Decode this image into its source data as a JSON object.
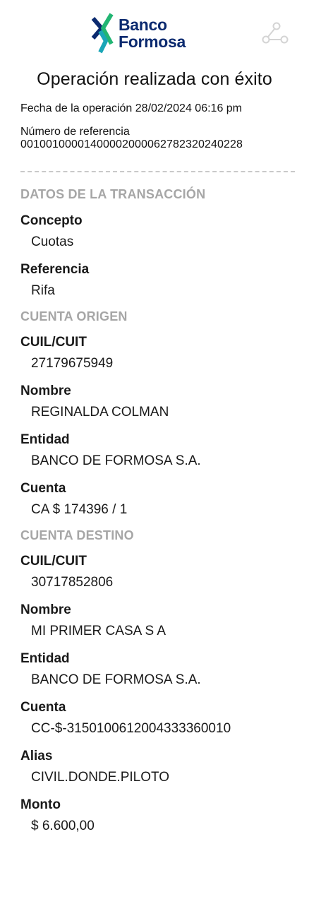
{
  "brand": {
    "name_line1": "Banco",
    "name_line2": "Formosa",
    "logo_icon": "banco-formosa-logo-icon",
    "share_icon": "share-icon"
  },
  "receipt": {
    "title": "Operación realizada con éxito",
    "date_line": "Fecha de la operación 28/02/2024 06:16 pm",
    "reference_label": "Número de referencia",
    "reference_number": "0010010000140000200006278232024022 8"
  },
  "transaction": {
    "section_title": "DATOS DE LA TRANSACCIÓN",
    "concepto_label": "Concepto",
    "concepto_value": "Cuotas",
    "referencia_label": "Referencia",
    "referencia_value": "Rifa"
  },
  "origin": {
    "section_title": "CUENTA ORIGEN",
    "cuit_label": "CUIL/CUIT",
    "cuit_value": "27179675949",
    "nombre_label": "Nombre",
    "nombre_value": "REGINALDA COLMAN",
    "entidad_label": "Entidad",
    "entidad_value": "BANCO DE FORMOSA S.A.",
    "cuenta_label": "Cuenta",
    "cuenta_value": "CA $ 174396 / 1"
  },
  "destination": {
    "section_title": "CUENTA DESTINO",
    "cuit_label": "CUIL/CUIT",
    "cuit_value": "30717852806",
    "nombre_label": "Nombre",
    "nombre_value": "MI PRIMER CASA S A",
    "entidad_label": "Entidad",
    "entidad_value": "BANCO DE FORMOSA S.A.",
    "cuenta_label": "Cuenta",
    "cuenta_value": "CC-$-3150100612004333360010",
    "alias_label": "Alias",
    "alias_value": "CIVIL.DONDE.PILOTO",
    "monto_label": "Monto",
    "monto_value": "$ 6.600,00"
  },
  "colors": {
    "brand_navy": "#0b2a6f",
    "brand_green": "#22b573",
    "brand_teal": "#1aa6b7",
    "section_gray": "#a6a6a6"
  }
}
